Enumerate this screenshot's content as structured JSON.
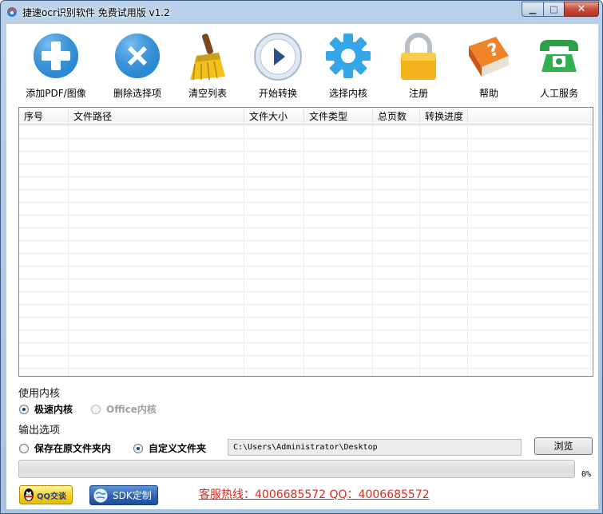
{
  "window": {
    "title": "捷速ocr识别软件 免费试用版 v1.2",
    "minimize_glyph": "▁",
    "maximize_glyph": "□",
    "close_glyph": "✕"
  },
  "toolbar": {
    "items": [
      {
        "label": "添加PDF/图像",
        "icon": "add-icon"
      },
      {
        "label": "删除选择项",
        "icon": "delete-icon"
      },
      {
        "label": "清空列表",
        "icon": "broom-icon"
      },
      {
        "label": "开始转换",
        "icon": "play-icon"
      },
      {
        "label": "选择内核",
        "icon": "gear-icon"
      },
      {
        "label": "注册",
        "icon": "lock-icon"
      },
      {
        "label": "帮助",
        "icon": "help-book-icon"
      },
      {
        "label": "人工服务",
        "icon": "telephone-icon"
      }
    ]
  },
  "table": {
    "columns": [
      "序号",
      "文件路径",
      "文件大小",
      "文件类型",
      "总页数",
      "转换进度"
    ],
    "rows": []
  },
  "engine": {
    "group_label": "使用内核",
    "options": [
      {
        "label": "极速内核",
        "selected": true,
        "enabled": true
      },
      {
        "label": "Office内核",
        "selected": false,
        "enabled": false
      }
    ]
  },
  "output": {
    "group_label": "输出选项",
    "options": [
      {
        "label": "保存在原文件夹内",
        "selected": false
      },
      {
        "label": "自定义文件夹",
        "selected": true
      }
    ],
    "path": "C:\\Users\\Administrator\\Desktop",
    "browse_label": "浏览"
  },
  "progress": {
    "value": 0,
    "text": "0%"
  },
  "footer": {
    "qq_label": "QQ交谈",
    "sdk_label": "SDK定制",
    "hotline": "客服热线：4006685572 QQ：4006685572"
  },
  "colors": {
    "accent_blue": "#2c8fd8",
    "hotline_red": "#d62d20",
    "progress_green": "#37c534"
  }
}
